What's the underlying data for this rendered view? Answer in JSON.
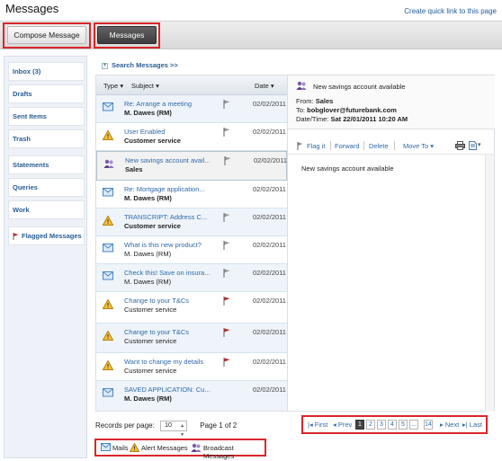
{
  "header": {
    "title": "Messages",
    "quick_link": "Create quick link to this page"
  },
  "toolbar": {
    "compose_label": "Compose Message",
    "messages_label": "Messages"
  },
  "sidebar": {
    "items": [
      {
        "label": "Inbox (3)"
      },
      {
        "label": "Drafts"
      },
      {
        "label": "Sent Items"
      },
      {
        "label": "Trash"
      },
      {
        "label": "Statements"
      },
      {
        "label": "Queries"
      },
      {
        "label": "Work"
      },
      {
        "label": "Flagged Messages",
        "icon": "red-flag-icon"
      }
    ]
  },
  "search": {
    "label": "Search Messages >>"
  },
  "list": {
    "headers": {
      "type": "Type",
      "subject": "Subject",
      "date": "Date"
    },
    "rows": [
      {
        "icon": "mail-icon",
        "subject": "Re: Arrange a meeting",
        "from": "M. Dawes (RM)",
        "from_bold": true,
        "flag": "grey",
        "date": "02/02/2011"
      },
      {
        "icon": "alert-icon",
        "subject": "User Enabled",
        "from": "Customer service",
        "from_bold": true,
        "flag": "grey",
        "date": "02/02/2011"
      },
      {
        "icon": "broadcast-icon",
        "subject": "New savings account avail...",
        "from": "Sales",
        "from_bold": true,
        "flag": "grey",
        "date": "02/02/2011",
        "selected": true
      },
      {
        "icon": "mail-icon",
        "subject": "Re: Mortgage application...",
        "from": "M. Dawes (RM)",
        "from_bold": true,
        "flag": "none",
        "date": "02/02/2011"
      },
      {
        "icon": "alert-icon",
        "subject": "TRANSCRIPT: Address C...",
        "from": "Customer service",
        "from_bold": true,
        "flag": "grey",
        "date": "02/02/2011"
      },
      {
        "icon": "mail-icon",
        "subject": "What is this new product?",
        "from": "M. Dawes (RM)",
        "from_bold": false,
        "flag": "grey",
        "date": "02/02/2011"
      },
      {
        "icon": "mail-icon",
        "subject": "Check this! Save on insura...",
        "from": "M. Dawes (RM)",
        "from_bold": false,
        "flag": "grey",
        "date": "02/02/2011"
      },
      {
        "icon": "alert-icon",
        "subject": "Change to your T&Cs",
        "from": "Customer service",
        "from_bold": false,
        "flag": "red",
        "date": "02/02/2011"
      },
      {
        "icon": "alert-icon",
        "subject": "Change to your T&Cs",
        "from": "Customer service",
        "from_bold": false,
        "flag": "red",
        "date": "02/02/2011"
      },
      {
        "icon": "alert-icon",
        "subject": "Want to change my details",
        "from": "Customer service",
        "from_bold": false,
        "flag": "red",
        "date": "02/02/2011"
      },
      {
        "icon": "mail-icon",
        "subject": "SAVED APPLICATION: Cu...",
        "from": "M. Dawes (RM)",
        "from_bold": true,
        "flag": "none",
        "date": "02/02/2011"
      }
    ]
  },
  "detail": {
    "subject": "New savings account available",
    "from_label": "From:",
    "from_value": "Sales",
    "to_label": "To:",
    "to_value": "bobglover@futurebank.com",
    "date_label": "Date/Time:",
    "date_value": "Sat 22/01/2011 10:20 AM",
    "actions": {
      "flag": "Flag it",
      "forward": "Forward",
      "delete": "Delete",
      "move": "Move To"
    },
    "body": "New savings account available"
  },
  "footer": {
    "records_label": "Records per page:",
    "records_value": "10",
    "page_info": "Page 1 of 2"
  },
  "pager": {
    "first": "First",
    "prev": "Prev",
    "pages": [
      "1",
      "2",
      "3",
      "4",
      "5",
      "...",
      "14"
    ],
    "current": "1",
    "next": "Next",
    "last": "Last"
  },
  "legend": {
    "mails": "Mails",
    "alerts": "Alert Messages",
    "broadcast": "Broadcast Messages"
  },
  "colors": {
    "accent_blue": "#2f6aa8",
    "highlight_red": "#d9262b",
    "alert_orange": "#e8a21f",
    "flag_red": "#c0272d"
  }
}
